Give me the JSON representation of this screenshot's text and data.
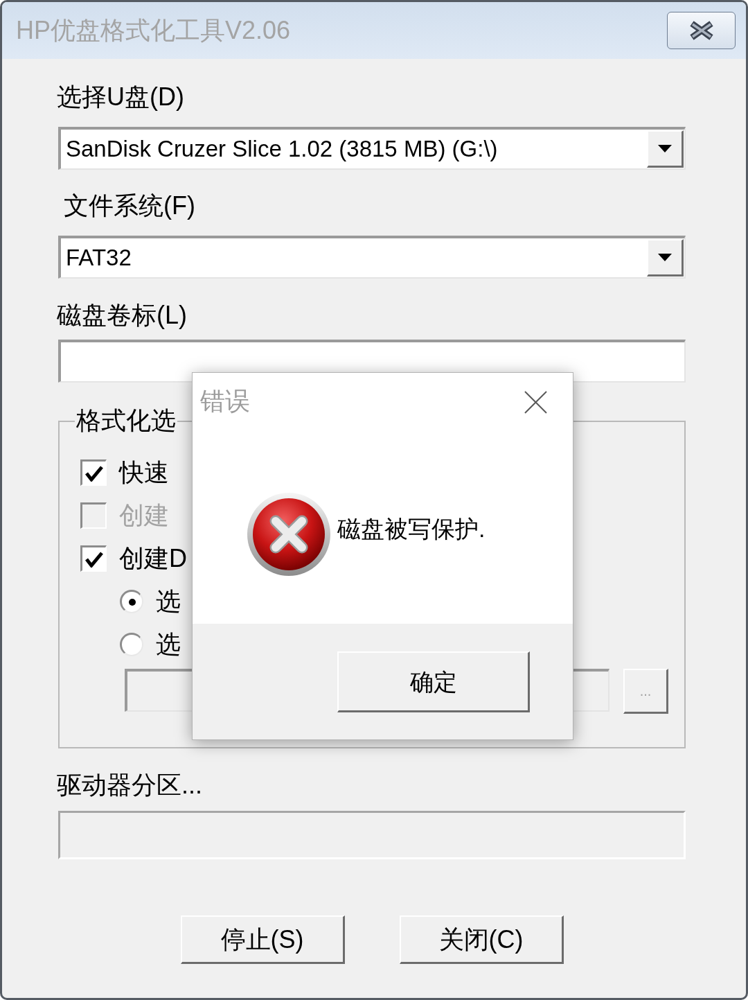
{
  "window": {
    "title": "HP优盘格式化工具V2.06"
  },
  "drive": {
    "label": "选择U盘(D)",
    "value": "SanDisk Cruzer Slice 1.02 (3815 MB) (G:\\)"
  },
  "file_system": {
    "label": "文件系统(F)",
    "value": "FAT32"
  },
  "volume_label": {
    "label": "磁盘卷标(L)"
  },
  "format_options": {
    "title": "格式化选",
    "options": [
      {
        "kind": "checkbox",
        "label": "快速",
        "checked": true,
        "disabled": false
      },
      {
        "kind": "checkbox",
        "label": "创建",
        "checked": false,
        "disabled": true
      },
      {
        "kind": "checkbox",
        "label": "创建D",
        "checked": true,
        "disabled": false
      },
      {
        "kind": "radio",
        "label": "选",
        "selected": true
      },
      {
        "kind": "radio",
        "label": "选",
        "selected": false
      }
    ],
    "path_field": {
      "disabled": true
    },
    "browse_button": {
      "label": "...",
      "disabled": true
    }
  },
  "partition_progress": {
    "label": "驱动器分区...",
    "level": 0
  },
  "buttons": [
    "停止(S)",
    "关闭(C)"
  ],
  "error_dialog": {
    "title": "错误",
    "message": "磁盘被写保护.",
    "ok_button": "确定"
  }
}
